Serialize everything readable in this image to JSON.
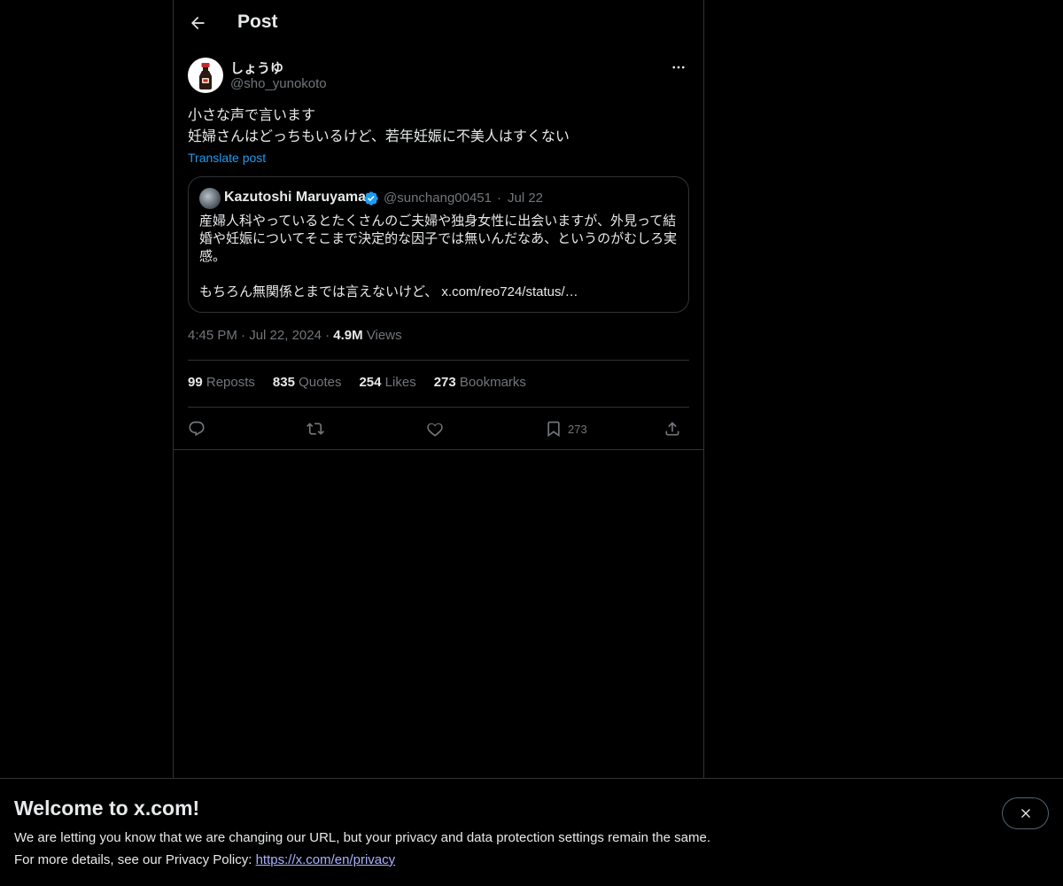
{
  "header": {
    "title": "Post"
  },
  "post": {
    "author_name": "しょうゆ",
    "author_handle": "@sho_yunokoto",
    "text_line1": "小さな声で言います",
    "text_line2": "妊婦さんはどっちもいるけど、若年妊娠に不美人はすくない",
    "translate_label": "Translate post",
    "time": "4:45 PM",
    "date": "Jul 22, 2024",
    "views_count": "4.9M",
    "views_label": "Views"
  },
  "quote": {
    "author_name": "Kazutoshi Maruyama",
    "author_handle": "@sunchang00451",
    "date": "Jul 22",
    "text": "産婦人科やっているとたくさんのご夫婦や独身女性に出会いますが、外見って結婚や妊娠についてそこまで決定的な因子では無いんだなあ、というのがむしろ実感。",
    "text2": "もちろん無関係とまでは言えないけど、 x.com/reo724/status/…"
  },
  "stats": {
    "reposts_count": "99",
    "reposts_label": "Reposts",
    "quotes_count": "835",
    "quotes_label": "Quotes",
    "likes_count": "254",
    "likes_label": "Likes",
    "bookmarks_count": "273",
    "bookmarks_label": "Bookmarks"
  },
  "actions": {
    "bookmark_count": "273"
  },
  "banner": {
    "title": "Welcome to x.com!",
    "line1": "We are letting you know that we are changing our URL, but your privacy and data protection settings remain the same.",
    "line2_prefix": "For more details, see our Privacy Policy: ",
    "link": "https://x.com/en/privacy"
  },
  "colors": {
    "background": "#000000",
    "text": "#e7e9ea",
    "muted": "#71767b",
    "accent": "#1d9bf0",
    "border": "#2f3336"
  }
}
